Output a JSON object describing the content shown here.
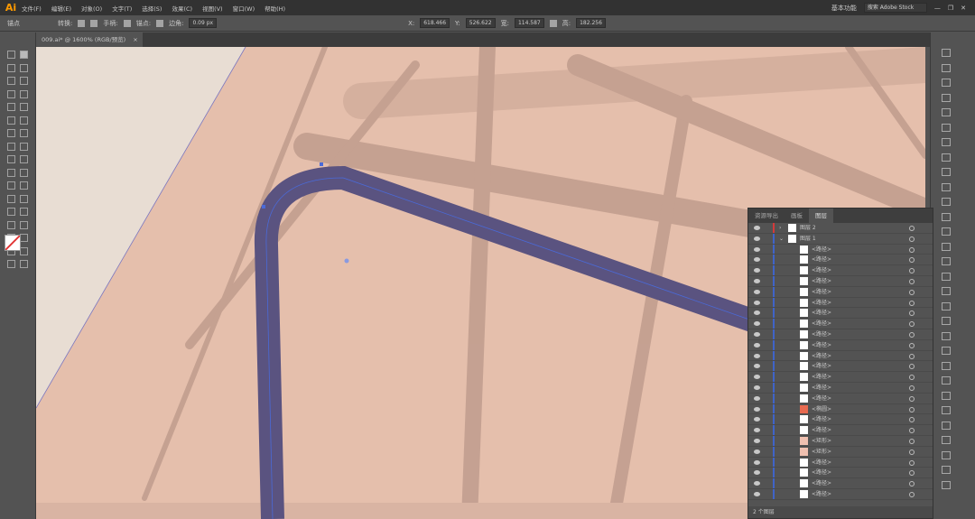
{
  "app": {
    "logo": "Ai"
  },
  "menu": [
    "文件(F)",
    "编辑(E)",
    "对象(O)",
    "文字(T)",
    "选择(S)",
    "效果(C)",
    "视图(V)",
    "窗口(W)",
    "帮助(H)"
  ],
  "workspace": "基本功能",
  "search_placeholder": "搜索 Adobe Stock",
  "control": {
    "mode": "锚点",
    "convert": "转换:",
    "handles": "手柄:",
    "anchors": "锚点:",
    "corner_label": "边角:",
    "corner_value": "0.09 px",
    "x_label": "X:",
    "x": "618.466",
    "y_label": "Y:",
    "y": "526.622",
    "w_label": "宽:",
    "w": "114.587",
    "h_label": "高:",
    "h": "182.256"
  },
  "document_tab": {
    "title": "009.ai* @ 1600% (RGB/预览)",
    "close": "×"
  },
  "layers_panel": {
    "tabs": [
      "资源导出",
      "画板",
      "图层"
    ],
    "layers": [
      {
        "name": "图层 2"
      },
      {
        "name": "图层 1"
      }
    ],
    "items": [
      "<路径>",
      "<路径>",
      "<路径>",
      "<路径>",
      "<路径>",
      "<路径>",
      "<路径>",
      "<路径>",
      "<路径>",
      "<路径>",
      "<路径>",
      "<路径>",
      "<路径>",
      "<路径>",
      "<路径>",
      "<椭圆>",
      "<路径>",
      "<路径>",
      "<矩形>",
      "<矩形>",
      "<路径>",
      "<路径>",
      "<路径>",
      "<路径>"
    ],
    "footer": "2 个图层"
  },
  "colors": {
    "canvas": "#e5bfac",
    "pasteboard": "#e8ddd3",
    "stroke": "#5a5380",
    "selection": "#4a6ad8",
    "layer2": "#d43a3a",
    "layer1": "#3f63c8"
  }
}
